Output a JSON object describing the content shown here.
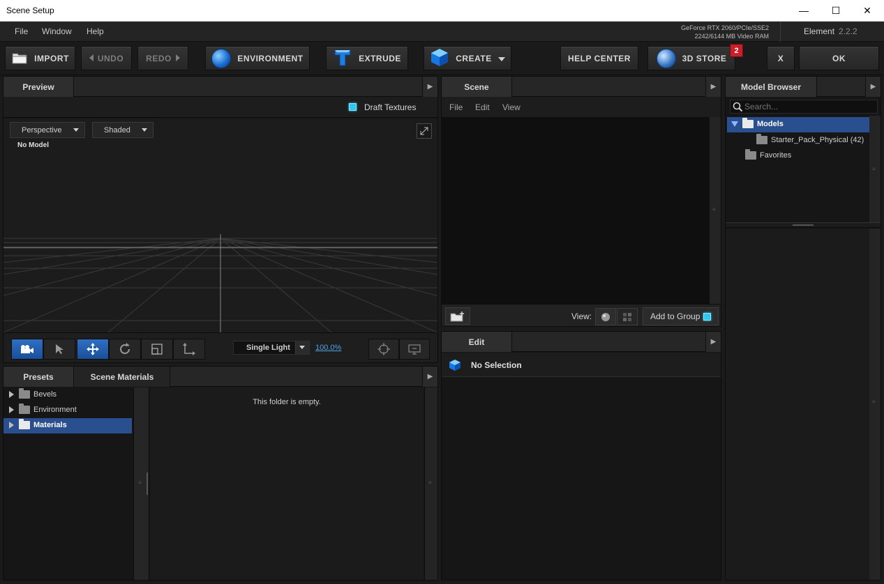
{
  "window": {
    "title": "Scene Setup",
    "controls": {
      "minimize": "—",
      "maximize": "☐",
      "close": "✕"
    }
  },
  "menu": {
    "items": [
      "File",
      "Window",
      "Help"
    ]
  },
  "status": {
    "gpu_line1": "GeForce RTX 2060/PCIe/SSE2",
    "gpu_line2": "2242/6144 MB Video RAM",
    "app_name": "Element",
    "app_version": "2.2.2"
  },
  "toolbar": {
    "import": "IMPORT",
    "undo": "UNDO",
    "redo": "REDO",
    "environment": "ENVIRONMENT",
    "extrude": "EXTRUDE",
    "create": "CREATE",
    "help_center": "HELP CENTER",
    "store": "3D STORE",
    "store_badge": "2",
    "cancel": "X",
    "ok": "OK"
  },
  "preview": {
    "tab": "Preview",
    "draft_textures": "Draft Textures",
    "camera_mode": "Perspective",
    "shading_mode": "Shaded",
    "model_status": "No Model",
    "light_mode": "Single Light",
    "zoom": "100.0%"
  },
  "scene": {
    "tab": "Scene",
    "menu": [
      "File",
      "Edit",
      "View"
    ],
    "view_label": "View:",
    "add_to_group": "Add to Group"
  },
  "edit": {
    "tab": "Edit",
    "selection": "No Selection"
  },
  "model_browser": {
    "tab": "Model Browser",
    "search_placeholder": "Search...",
    "root": "Models",
    "children": [
      "Starter_Pack_Physical (42)"
    ],
    "favorites": "Favorites"
  },
  "presets": {
    "tabs": [
      "Presets",
      "Scene Materials"
    ],
    "folders": [
      "Bevels",
      "Environment",
      "Materials"
    ],
    "empty_message": "This folder is empty."
  },
  "colors": {
    "accent": "#30c6ef",
    "selection": "#2a4f8f",
    "badge": "#c8202a"
  }
}
